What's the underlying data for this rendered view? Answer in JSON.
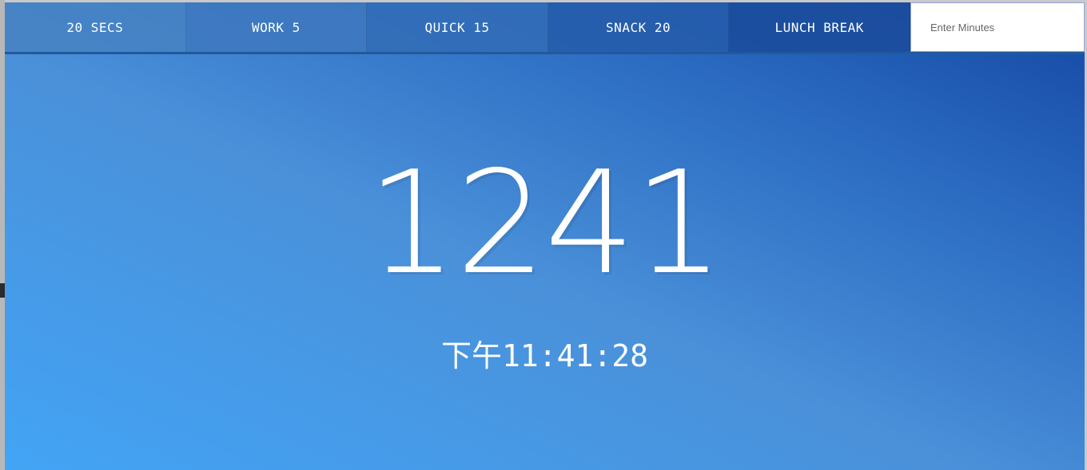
{
  "timer_buttons": [
    {
      "label": "20 SECS"
    },
    {
      "label": "WORK 5"
    },
    {
      "label": "QUICK 15"
    },
    {
      "label": "SNACK 20"
    },
    {
      "label": "LUNCH BREAK"
    }
  ],
  "custom_minutes": {
    "placeholder": "Enter Minutes",
    "value": ""
  },
  "display": {
    "time_left": "1241",
    "end_time": "下午11:41:28"
  },
  "colors": {
    "gradient_light": "#43a4f5",
    "gradient_mid": "#4a90d9",
    "gradient_dark": "#1447a3",
    "text": "#ffffff"
  }
}
